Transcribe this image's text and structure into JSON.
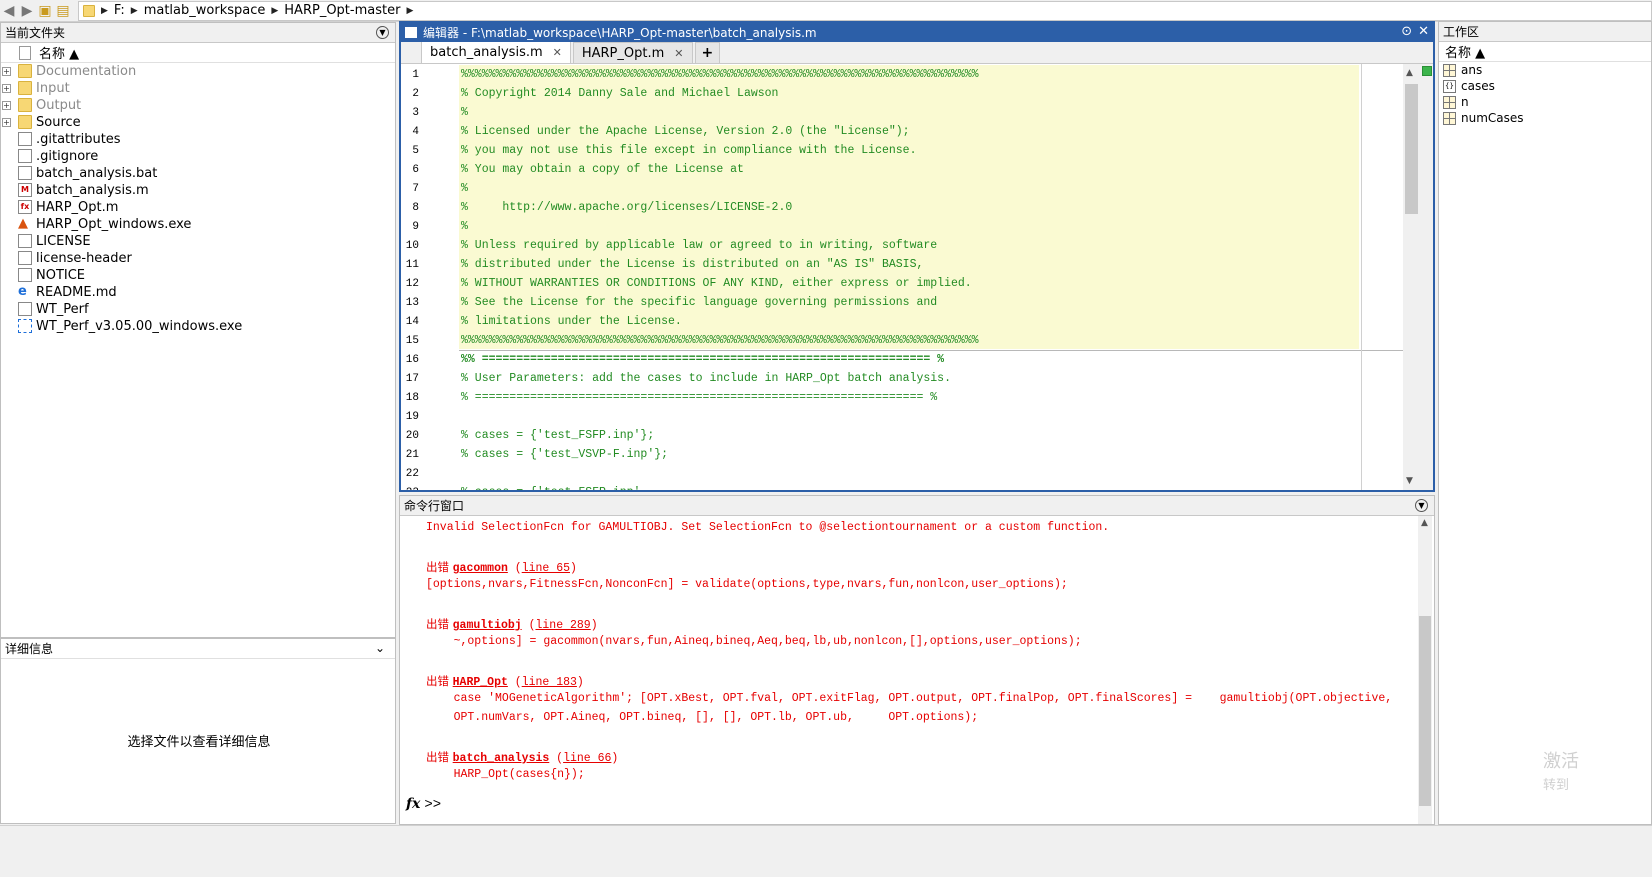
{
  "address_bar": {
    "crumbs": [
      "F:",
      "matlab_workspace",
      "HARP_Opt-master"
    ]
  },
  "file_panel": {
    "title": "当前文件夹",
    "column_header": "名称 ▲",
    "items": [
      {
        "name": "Documentation",
        "type": "folder",
        "expandable": true,
        "dim": true
      },
      {
        "name": "Input",
        "type": "folder",
        "expandable": true,
        "dim": true
      },
      {
        "name": "Output",
        "type": "folder",
        "expandable": true,
        "dim": true
      },
      {
        "name": "Source",
        "type": "folder",
        "expandable": true,
        "dim": false
      },
      {
        "name": ".gitattributes",
        "type": "file"
      },
      {
        "name": ".gitignore",
        "type": "file"
      },
      {
        "name": "batch_analysis.bat",
        "type": "bat"
      },
      {
        "name": "batch_analysis.m",
        "type": "m"
      },
      {
        "name": "HARP_Opt.m",
        "type": "fx"
      },
      {
        "name": "HARP_Opt_windows.exe",
        "type": "exe"
      },
      {
        "name": "LICENSE",
        "type": "file"
      },
      {
        "name": "license-header",
        "type": "file"
      },
      {
        "name": "NOTICE",
        "type": "file"
      },
      {
        "name": "README.md",
        "type": "ie"
      },
      {
        "name": "WT_Perf",
        "type": "file"
      },
      {
        "name": "WT_Perf_v3.05.00_windows.exe",
        "type": "wt"
      }
    ]
  },
  "detail_panel": {
    "title": "详细信息",
    "message": "选择文件以查看详细信息"
  },
  "editor": {
    "title": "编辑器 - F:\\matlab_workspace\\HARP_Opt-master\\batch_analysis.m",
    "tabs": [
      {
        "label": "batch_analysis.m",
        "active": true
      },
      {
        "label": "HARP_Opt.m",
        "active": false
      }
    ],
    "add_tab": "+",
    "lines": [
      {
        "n": "1",
        "text": "%%%%%%%%%%%%%%%%%%%%%%%%%%%%%%%%%%%%%%%%%%%%%%%%%%%%%%%%%%%%%%%%%%%%%%%%%%%",
        "style": "green"
      },
      {
        "n": "2",
        "text": "% Copyright 2014 Danny Sale and Michael Lawson",
        "style": "green"
      },
      {
        "n": "3",
        "text": "%",
        "style": "green"
      },
      {
        "n": "4",
        "text": "% Licensed under the Apache License, Version 2.0 (the \"License\");",
        "style": "green"
      },
      {
        "n": "5",
        "text": "% you may not use this file except in compliance with the License.",
        "style": "green"
      },
      {
        "n": "6",
        "text": "% You may obtain a copy of the License at",
        "style": "green"
      },
      {
        "n": "7",
        "text": "%",
        "style": "green"
      },
      {
        "n": "8",
        "text": "%     http://www.apache.org/licenses/LICENSE-2.0",
        "style": "green"
      },
      {
        "n": "9",
        "text": "%",
        "style": "green"
      },
      {
        "n": "10",
        "text": "% Unless required by applicable law or agreed to in writing, software",
        "style": "green"
      },
      {
        "n": "11",
        "text": "% distributed under the License is distributed on an \"AS IS\" BASIS,",
        "style": "green"
      },
      {
        "n": "12",
        "text": "% WITHOUT WARRANTIES OR CONDITIONS OF ANY KIND, either express or implied.",
        "style": "green"
      },
      {
        "n": "13",
        "text": "% See the License for the specific language governing permissions and",
        "style": "green"
      },
      {
        "n": "14",
        "text": "% limitations under the License.",
        "style": "green"
      },
      {
        "n": "15",
        "text": "%%%%%%%%%%%%%%%%%%%%%%%%%%%%%%%%%%%%%%%%%%%%%%%%%%%%%%%%%%%%%%%%%%%%%%%%%%%",
        "style": "green"
      },
      {
        "n": "16",
        "text": "%% ================================================================= %",
        "style": "green-bold"
      },
      {
        "n": "17",
        "text": "% User Parameters: add the cases to include in HARP_Opt batch analysis.",
        "style": "green"
      },
      {
        "n": "18",
        "text": "% ================================================================= %",
        "style": "green"
      },
      {
        "n": "19",
        "text": "",
        "style": "green"
      },
      {
        "n": "20",
        "text": "% cases = {'test_FSFP.inp'};",
        "style": "green"
      },
      {
        "n": "21",
        "text": "% cases = {'test_VSVP-F.inp'};",
        "style": "green"
      },
      {
        "n": "22",
        "text": "",
        "style": "green"
      },
      {
        "n": "23",
        "text": "% cases = {'test_FSFP.inp',",
        "style": "green"
      }
    ]
  },
  "command_window": {
    "title": "命令行窗口",
    "lines": [
      {
        "segments": [
          {
            "t": "Invalid SelectionFcn for GAMULTIOBJ. Set SelectionFcn to @selectiontournament or a custom function.",
            "k": "plain"
          }
        ]
      },
      {
        "segments": [
          {
            "t": "出错 ",
            "k": "cn"
          },
          {
            "t": "gacommon",
            "k": "fn"
          },
          {
            "t": " (",
            "k": "plain"
          },
          {
            "t": "line 65",
            "k": "link"
          },
          {
            "t": ")",
            "k": "plain"
          }
        ]
      },
      {
        "segments": [
          {
            "t": "[options,nvars,FitnessFcn,NonconFcn] = validate(options,type,nvars,fun,nonlcon,user_options);",
            "k": "plain"
          }
        ]
      },
      {
        "segments": [
          {
            "t": "出错 ",
            "k": "cn"
          },
          {
            "t": "gamultiobj",
            "k": "fn"
          },
          {
            "t": " (",
            "k": "plain"
          },
          {
            "t": "line 289",
            "k": "link"
          },
          {
            "t": ")",
            "k": "plain"
          }
        ]
      },
      {
        "segments": [
          {
            "t": "    ~,options] = gacommon(nvars,fun,Aineq,bineq,Aeq,beq,lb,ub,nonlcon,[],options,user_options);",
            "k": "plain"
          }
        ]
      },
      {
        "segments": [
          {
            "t": "出错 ",
            "k": "cn"
          },
          {
            "t": "HARP_Opt",
            "k": "fn"
          },
          {
            "t": " (",
            "k": "plain"
          },
          {
            "t": "line 183",
            "k": "link"
          },
          {
            "t": ")",
            "k": "plain"
          }
        ]
      },
      {
        "segments": [
          {
            "t": "    case 'MOGeneticAlgorithm'; [OPT.xBest, OPT.fval, OPT.exitFlag, OPT.output, OPT.finalPop, OPT.finalScores] =    gamultiobj(OPT.objective,",
            "k": "plain"
          }
        ]
      },
      {
        "segments": [
          {
            "t": "    OPT.numVars, OPT.Aineq, OPT.bineq, [], [], OPT.lb, OPT.ub,     OPT.options);",
            "k": "plain"
          }
        ]
      },
      {
        "segments": [
          {
            "t": "出错 ",
            "k": "cn"
          },
          {
            "t": "batch_analysis",
            "k": "fn"
          },
          {
            "t": " (",
            "k": "plain"
          },
          {
            "t": "line 66",
            "k": "link"
          },
          {
            "t": ")",
            "k": "plain"
          }
        ]
      },
      {
        "segments": [
          {
            "t": "    HARP_Opt(cases{n});",
            "k": "plain"
          }
        ]
      }
    ],
    "prompt_symbol": "fx",
    "prompt": ">>"
  },
  "workspace": {
    "title": "工作区",
    "column_header": "名称 ▲",
    "vars": [
      {
        "name": "ans",
        "icon": "grid"
      },
      {
        "name": "cases",
        "icon": "cell"
      },
      {
        "name": "n",
        "icon": "grid"
      },
      {
        "name": "numCases",
        "icon": "grid"
      }
    ],
    "watermark_1": "激活",
    "watermark_2": "转到"
  }
}
